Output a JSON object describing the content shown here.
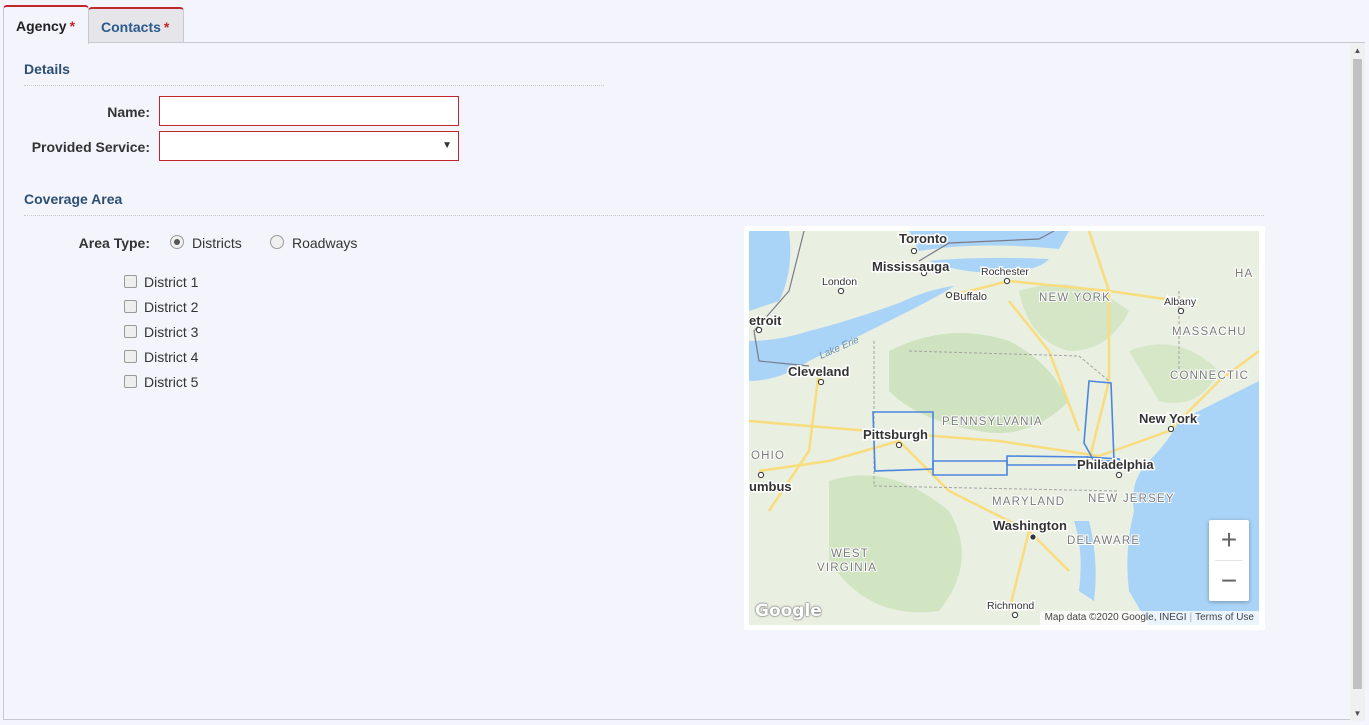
{
  "tabs": [
    {
      "label": "Agency",
      "required": "*"
    },
    {
      "label": "Contacts",
      "required": "*"
    }
  ],
  "details": {
    "title": "Details",
    "name_label": "Name:",
    "name_value": "",
    "service_label": "Provided Service:",
    "service_value": ""
  },
  "coverage": {
    "title": "Coverage Area",
    "area_type_label": "Area Type:",
    "area_types": [
      {
        "label": "Districts",
        "checked": true
      },
      {
        "label": "Roadways",
        "checked": false
      }
    ],
    "districts": [
      {
        "label": "District 1",
        "checked": false
      },
      {
        "label": "District 2",
        "checked": false
      },
      {
        "label": "District 3",
        "checked": false
      },
      {
        "label": "District 4",
        "checked": false
      },
      {
        "label": "District 5",
        "checked": false
      }
    ]
  },
  "map": {
    "place_labels": {
      "toronto": "Toronto",
      "mississauga": "Mississauga",
      "rochester": "Rochester",
      "london": "London",
      "buffalo": "Buffalo",
      "new_york_state": "NEW YORK",
      "albany": "Albany",
      "massachusetts": "MASSACHU",
      "detroit": "etroit",
      "lake_erie": "Lake Erie",
      "cleveland": "Cleveland",
      "connecticut": "CONNECTIC",
      "pennsylvania": "PENNSYLVANIA",
      "pittsburgh": "Pittsburgh",
      "new_york_city": "New York",
      "ohio": "OHIO",
      "philadelphia": "Philadelphia",
      "columbus": "umbus",
      "maryland": "MARYLAND",
      "new_jersey": "NEW JERSEY",
      "washington": "Washington",
      "delaware": "DELAWARE",
      "west_virginia_1": "WEST",
      "west_virginia_2": "VIRGINIA",
      "richmond": "Richmond",
      "ha": "HA"
    },
    "zoom_in": "+",
    "zoom_out": "−",
    "logo": "Google",
    "attribution": "Map data ©2020 Google, INEGI",
    "terms": "Terms of Use",
    "colors": {
      "water": "#a9d3f7",
      "land": "#e9efe1",
      "forest": "#cfe3c0",
      "highway": "#f9dc7d",
      "district_outline": "#4a86e0"
    }
  }
}
